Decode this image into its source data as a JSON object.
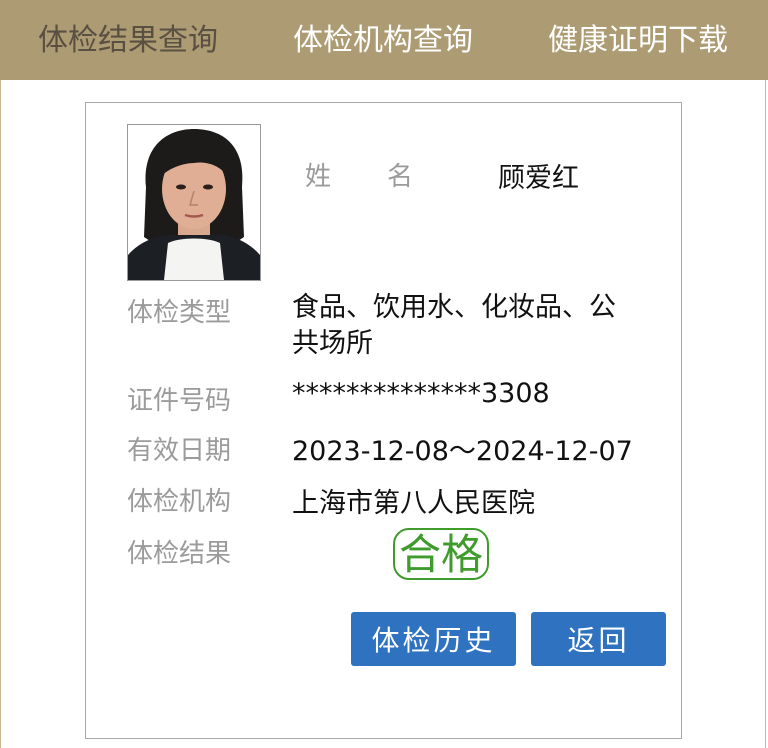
{
  "tabs": [
    {
      "label": "体检结果查询",
      "active": true
    },
    {
      "label": "体检机构查询",
      "active": false
    },
    {
      "label": "健康证明下载",
      "active": false
    }
  ],
  "record": {
    "name_label_1": "姓",
    "name_label_2": "名",
    "name": "顾爱红",
    "type_label": "体检类型",
    "type": "食品、饮用水、化妆品、公共场所",
    "id_label": "证件号码",
    "id": "**************3308",
    "validity_label": "有效日期",
    "validity": "2023-12-08～2024-12-07",
    "institution_label": "体检机构",
    "institution": "上海市第八人民医院",
    "result_label": "体检结果",
    "result": "合格"
  },
  "buttons": {
    "history": "体检历史",
    "back": "返回"
  },
  "colors": {
    "tab_bar": "#ad9b73",
    "active_tab_text": "#5a5042",
    "button": "#2f72c0",
    "pass_badge": "#3f9b2b",
    "label_text": "#9b9b9b"
  }
}
